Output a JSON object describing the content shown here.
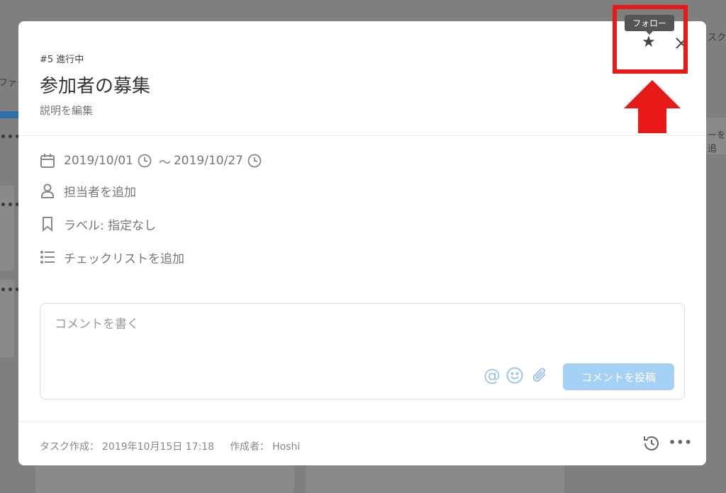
{
  "background": {
    "left_label": "ファイ",
    "right_top_label": "スク",
    "right_add_label": "ーを追"
  },
  "task": {
    "meta": "#5 進行中",
    "title": "参加者の募集",
    "edit_description": "説明を編集",
    "start_date": "2019/10/01",
    "tilde": "～",
    "end_date": "2019/10/27",
    "assignee": "担当者を追加",
    "label": "ラベル: 指定なし",
    "checklist": "チェックリストを追加"
  },
  "header_actions": {
    "tooltip": "フォロー",
    "star_icon": "star-icon",
    "close_icon": "close-icon"
  },
  "comment": {
    "placeholder": "コメントを書く",
    "post_button": "コメントを投稿",
    "at_symbol": "@"
  },
  "footer": {
    "created_label": "タスク作成：",
    "created_at": "2019年10月15日 17:18",
    "author_label": "作成者：",
    "author": "Hoshi"
  },
  "colors": {
    "accent_light_blue": "#a6d1f7",
    "annotation_red": "#e81919",
    "overlay_gray": "#7f7f7f"
  }
}
